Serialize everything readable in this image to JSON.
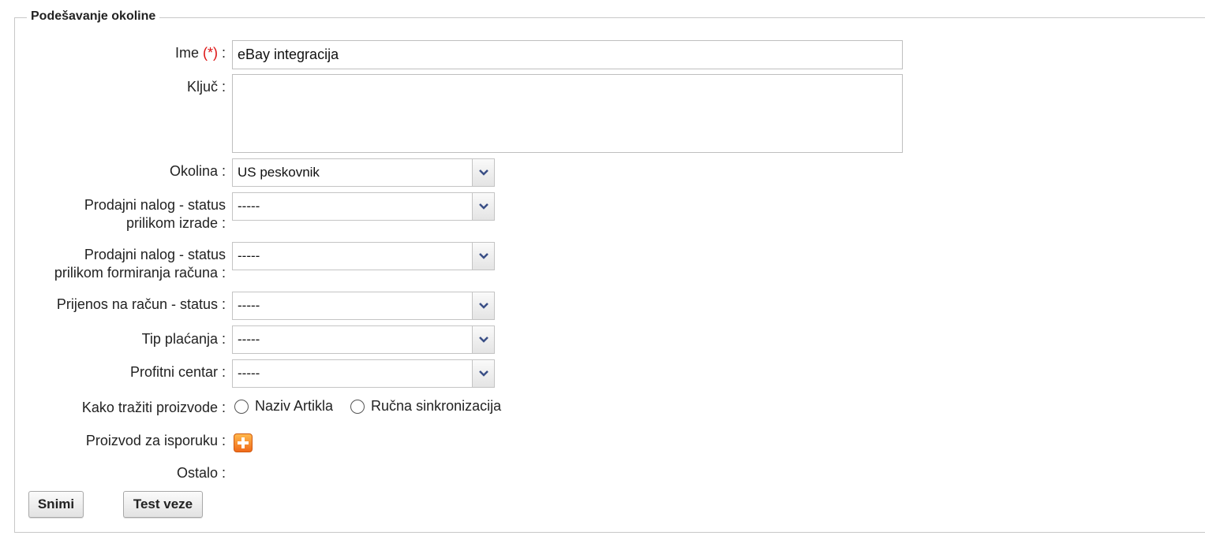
{
  "panel": {
    "title": "Podešavanje okoline"
  },
  "fields": {
    "ime": {
      "label": "Ime",
      "required_mark": "(*)",
      "suffix": " :",
      "value": "eBay integracija"
    },
    "kljuc": {
      "label": "Ključ :",
      "value": ""
    },
    "okolina": {
      "label": "Okolina :",
      "value": "US peskovnik"
    },
    "status_izrade": {
      "label_line1": "Prodajni nalog - status",
      "label_line2": "prilikom izrade :",
      "value": "-----"
    },
    "status_racuna": {
      "label_line1": "Prodajni nalog - status",
      "label_line2": "prilikom formiranja računa :",
      "value": "-----"
    },
    "prijenos": {
      "label": "Prijenos na račun - status :",
      "value": "-----"
    },
    "tip_placanja": {
      "label": "Tip plaćanja :",
      "value": "-----"
    },
    "profitni_centar": {
      "label": "Profitni centar :",
      "value": "-----"
    },
    "kako_traziti": {
      "label": "Kako tražiti proizvode :",
      "options": [
        "Naziv Artikla",
        "Ručna sinkronizacija"
      ]
    },
    "proizvod_isporuka": {
      "label": "Proizvod za isporuku :"
    },
    "ostalo": {
      "label": "Ostalo :"
    }
  },
  "buttons": {
    "save": "Snimi",
    "test": "Test veze"
  },
  "colors": {
    "required": "#dd1111",
    "add_icon": "#f07a1f",
    "dropdown_arrow": "#3a4f86"
  },
  "icons": {
    "dropdown": "chevron-down-icon",
    "add": "plus-icon"
  }
}
